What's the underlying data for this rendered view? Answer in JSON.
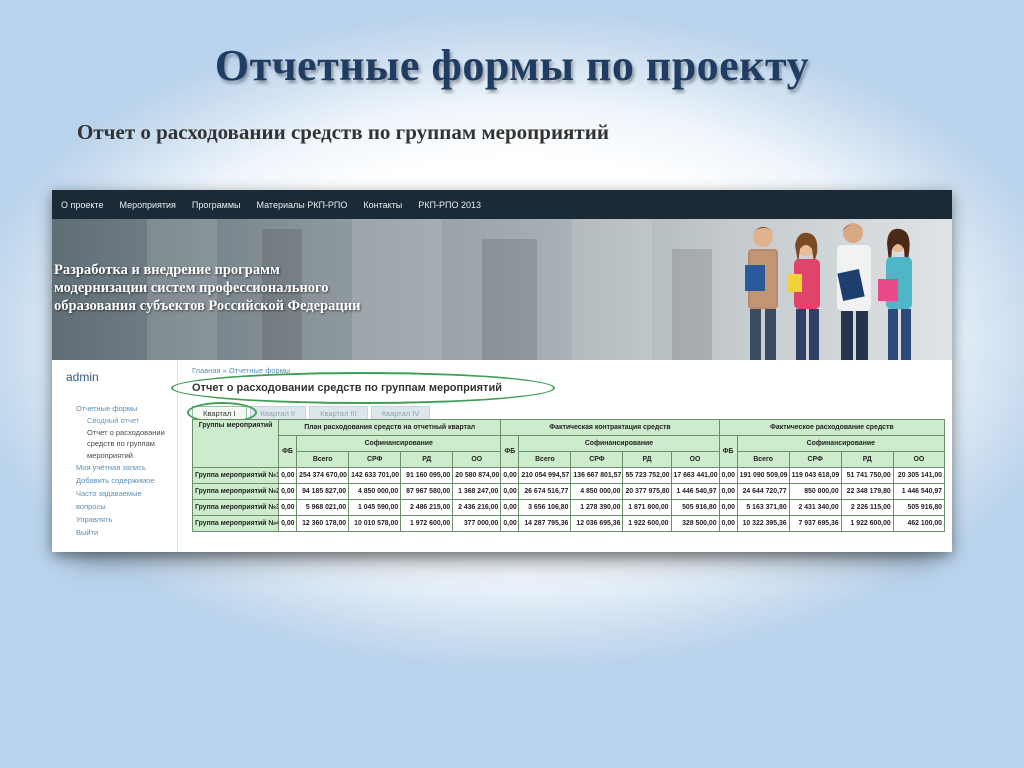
{
  "slide": {
    "title": "Отчетные формы по проекту",
    "subtitle": "Отчет о расходовании средств по группам мероприятий"
  },
  "nav": [
    "О проекте",
    "Мероприятия",
    "Программы",
    "Материалы РКП-РПО",
    "Контакты",
    "РКП-РПО 2013"
  ],
  "banner": {
    "lines": [
      "Разработка и внедрение программ",
      "модернизации систем профессионального",
      "образования субъектов Российской Федерации"
    ]
  },
  "sidebar": {
    "user": "admin",
    "items": [
      {
        "label": "Отчетные формы",
        "sub": false
      },
      {
        "label": "Сводный отчет",
        "sub": true
      },
      {
        "label": "Отчет о расходовании",
        "sub": true
      },
      {
        "label": "средств по группам",
        "sub": true
      },
      {
        "label": "мероприятий",
        "sub": true
      },
      {
        "label": "Моя учётная запись",
        "sub": false
      },
      {
        "label": "Добавить содержимое",
        "sub": false
      },
      {
        "label": "Часто задаваемые",
        "sub": false
      },
      {
        "label": "вопросы",
        "sub": false
      },
      {
        "label": "Управлять",
        "sub": false
      },
      {
        "label": "Выйти",
        "sub": false
      }
    ]
  },
  "content": {
    "breadcrumb": "Главная » Отчетные формы",
    "heading": "Отчет о расходовании средств по группам мероприятий",
    "tabs": [
      "Квартал I",
      "Квартал II",
      "Квартал III",
      "Квартал IV"
    ],
    "active_tab": 0
  },
  "table": {
    "row_header": "Группы мероприятий",
    "groups": [
      "План расходования средств на отчетный квартал",
      "Фактическая контрактация средств",
      "Фактическое расходование средств"
    ],
    "fb": "ФБ",
    "cofin": "Софинансирование",
    "subcols": [
      "Всего",
      "СРФ",
      "РД",
      "ОО"
    ],
    "rows": [
      {
        "name": "Группа мероприятий №1",
        "cells": [
          "0,00",
          "254 374 670,00",
          "142 633 701,00",
          "91 160 095,00",
          "20 580 874,00",
          "0,00",
          "210 054 994,57",
          "136 667 801,57",
          "55 723 752,00",
          "17 663 441,00",
          "0,00",
          "191 090 509,09",
          "119 043 618,09",
          "51 741 750,00",
          "20 305 141,00"
        ]
      },
      {
        "name": "Группа мероприятий №2",
        "cells": [
          "0,00",
          "94 185 827,00",
          "4 850 000,00",
          "87 967 580,00",
          "1 368 247,00",
          "0,00",
          "26 674 516,77",
          "4 850 000,00",
          "20 377 975,80",
          "1 446 540,97",
          "0,00",
          "24 644 720,77",
          "850 000,00",
          "22 348 179,80",
          "1 446 540,97"
        ]
      },
      {
        "name": "Группа мероприятий №3",
        "cells": [
          "0,00",
          "5 968 021,00",
          "1 045 590,00",
          "2 486 215,00",
          "2 436 216,00",
          "0,00",
          "3 656 106,80",
          "1 278 390,00",
          "1 871 800,00",
          "505 916,80",
          "0,00",
          "5 163 371,80",
          "2 431 340,00",
          "2 226 115,00",
          "505 916,80"
        ]
      },
      {
        "name": "Группа мероприятий №4",
        "cells": [
          "0,00",
          "12 360 178,00",
          "10 010 578,00",
          "1 972 600,00",
          "377 000,00",
          "0,00",
          "14 287 795,36",
          "12 036 695,36",
          "1 922 600,00",
          "328 500,00",
          "0,00",
          "10 322 395,36",
          "7 937 695,36",
          "1 922 600,00",
          "462 100,00"
        ]
      }
    ]
  },
  "colors": {
    "title": "#1f3c63",
    "nav_bg": "#1b2a36",
    "table_header": "#cdeccd",
    "highlight": "#3f9f55",
    "link": "#5a8fb8"
  }
}
